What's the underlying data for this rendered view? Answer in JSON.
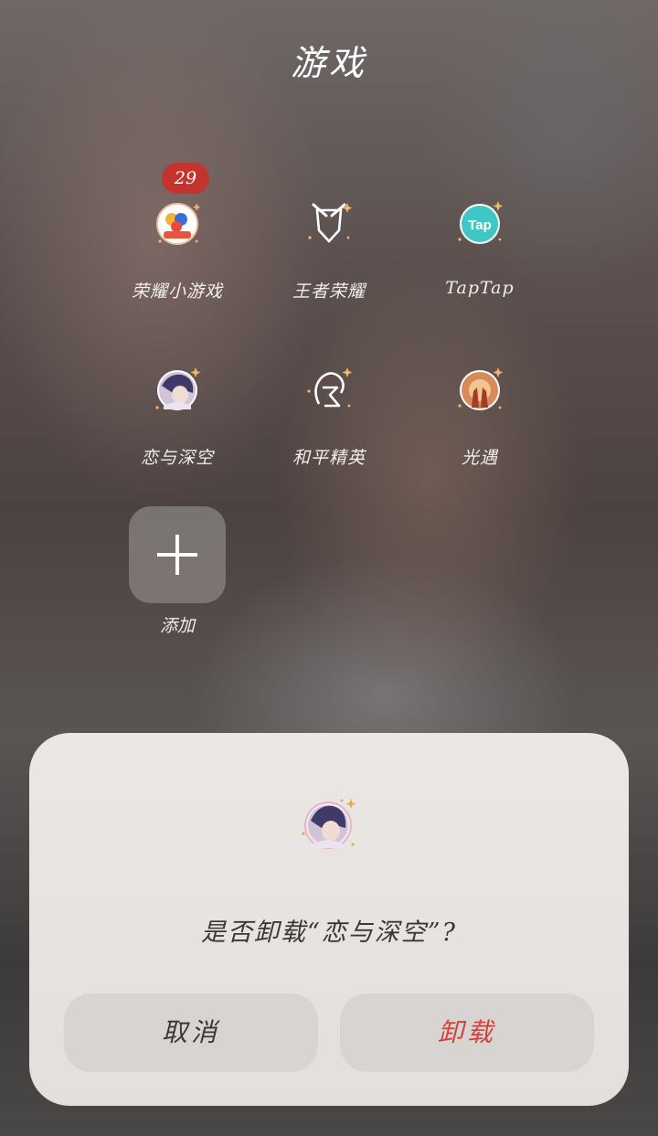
{
  "folder": {
    "title": "游戏",
    "apps": [
      {
        "label": "荣耀小游戏",
        "badge": "29",
        "icon": "honor-mini-games-icon"
      },
      {
        "label": "王者荣耀",
        "icon": "honor-of-kings-icon"
      },
      {
        "label": "TapTap",
        "icon": "taptap-icon",
        "icon_text": "Tap"
      },
      {
        "label": "恋与深空",
        "icon": "love-and-deepspace-icon"
      },
      {
        "label": "和平精英",
        "icon": "peacekeeper-elite-icon"
      },
      {
        "label": "光遇",
        "icon": "sky-icon"
      }
    ],
    "add": {
      "label": "添加",
      "icon": "plus-icon"
    }
  },
  "dialog": {
    "icon": "love-and-deepspace-icon",
    "message": "是否卸载“恋与深空”?",
    "cancel_label": "取消",
    "uninstall_label": "卸载",
    "uninstall_color": "#d2423c"
  },
  "colors": {
    "badge": "#c3342f",
    "taptap": "#3fc7c4"
  }
}
